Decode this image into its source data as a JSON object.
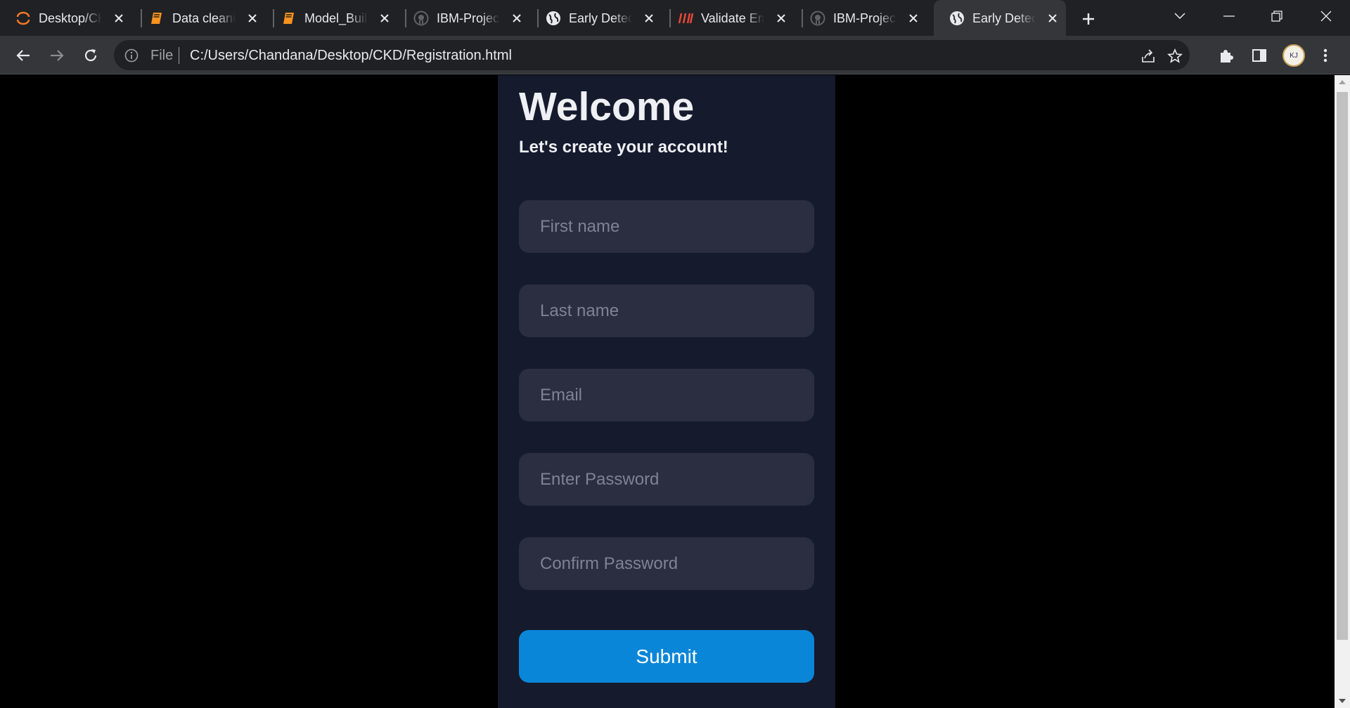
{
  "browser": {
    "tabs": [
      {
        "title": "Desktop/CKD/",
        "icon": "jupyter-icon"
      },
      {
        "title": "Data cleaning",
        "icon": "notebook-icon"
      },
      {
        "title": "Model_Building",
        "icon": "notebook-icon"
      },
      {
        "title": "IBM-Project",
        "icon": "github-icon"
      },
      {
        "title": "Early Detection",
        "icon": "globe-icon"
      },
      {
        "title": "Validate Email",
        "icon": "slashes-icon"
      },
      {
        "title": "IBM-Project",
        "icon": "github-icon"
      },
      {
        "title": "Early Detection",
        "icon": "globe-icon",
        "active": true
      }
    ],
    "address": {
      "scheme": "File",
      "url": "C:/Users/Chandana/Desktop/CKD/Registration.html"
    },
    "avatar_text": "KJ"
  },
  "form": {
    "title": "Welcome",
    "subtitle": "Let's create your account!",
    "fields": [
      {
        "placeholder": "First name",
        "value": ""
      },
      {
        "placeholder": "Last name",
        "value": ""
      },
      {
        "placeholder": "Email",
        "value": ""
      },
      {
        "placeholder": "Enter Password",
        "value": ""
      },
      {
        "placeholder": "Confirm Password",
        "value": ""
      }
    ],
    "submit_label": "Submit"
  },
  "colors": {
    "page_bg": "#000000",
    "card_bg": "#151a2d",
    "field_bg": "#2b2e40",
    "submit_bg": "#0a86d8",
    "tabstrip_bg": "#202124",
    "toolbar_bg": "#35363a"
  }
}
